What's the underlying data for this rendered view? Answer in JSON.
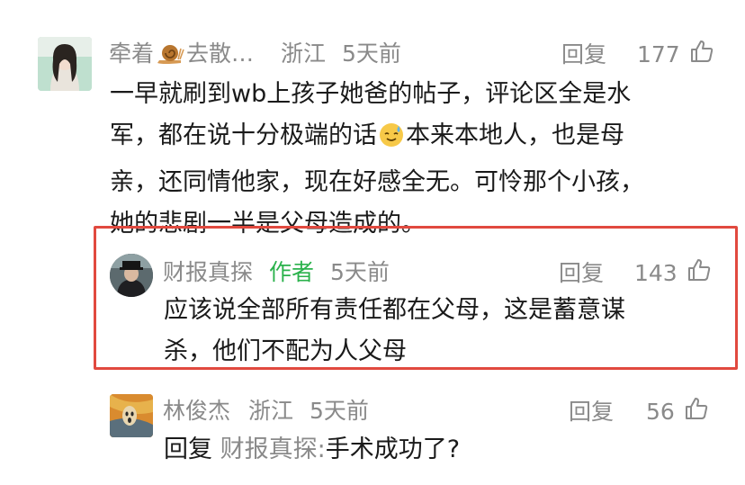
{
  "comments": [
    {
      "user": "牵着",
      "user_suffix": "去散…",
      "user_emoji_icon": "snail-icon",
      "location": "浙江",
      "time": "5天前",
      "reply_label": "回复",
      "likes": "177",
      "text_lines": [
        "一早就刷到wb上孩子她爸的帖子，评论区全是水",
        "军，都在说十分极端的话",
        "本来本地人，也是母",
        "亲，还同情他家，现在好感全无。可怜那个小孩，",
        "她的悲剧一半是父母造成的。"
      ],
      "inline_emoji_icon": "sweat-smile-emoji-icon"
    },
    {
      "user": "财报真探",
      "author_tag": "作者",
      "time": "5天前",
      "reply_label": "回复",
      "likes": "143",
      "text_lines": [
        "应该说全部所有责任都在父母，这是蓄意谋",
        "杀，他们不配为人父母"
      ]
    },
    {
      "user": "林俊杰",
      "location": "浙江",
      "time": "5天前",
      "reply_label": "回复",
      "likes": "56",
      "reply_prefix": "回复",
      "reply_target": "财报真探:",
      "reply_text": "手术成功了?"
    }
  ],
  "colors": {
    "meta_gray": "#8a8a8a",
    "author_green": "#2bb24c",
    "highlight_red": "#e1493f"
  }
}
